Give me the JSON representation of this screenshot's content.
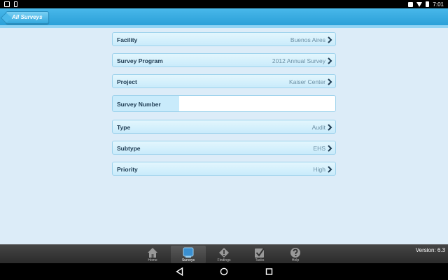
{
  "status_bar": {
    "time": "7:01"
  },
  "header": {
    "back_label": "All Surveys"
  },
  "form": {
    "rows": [
      {
        "label": "Facility",
        "value": "Buenos Aires"
      },
      {
        "label": "Survey Program",
        "value": "2012 Annual Survey"
      },
      {
        "label": "Project",
        "value": "Kaiser Center"
      }
    ],
    "survey_number": {
      "label": "Survey Number",
      "value": "",
      "placeholder": ""
    },
    "rows2": [
      {
        "label": "Type",
        "value": "Audit"
      },
      {
        "label": "Subtype",
        "value": "EHS"
      },
      {
        "label": "Priority",
        "value": "High"
      }
    ]
  },
  "tabbar": {
    "tabs": [
      {
        "label": "Home",
        "icon": "home-icon"
      },
      {
        "label": "Surveys",
        "icon": "surveys-icon",
        "active": true
      },
      {
        "label": "Findings",
        "icon": "findings-icon"
      },
      {
        "label": "Tasks",
        "icon": "tasks-icon"
      },
      {
        "label": "Help",
        "icon": "help-icon"
      }
    ],
    "version": "Version: 6.3"
  },
  "colors": {
    "header": "#2aa0d8",
    "background": "#dcecf8",
    "row": "#c9ebfb",
    "label": "#1e3b52"
  }
}
